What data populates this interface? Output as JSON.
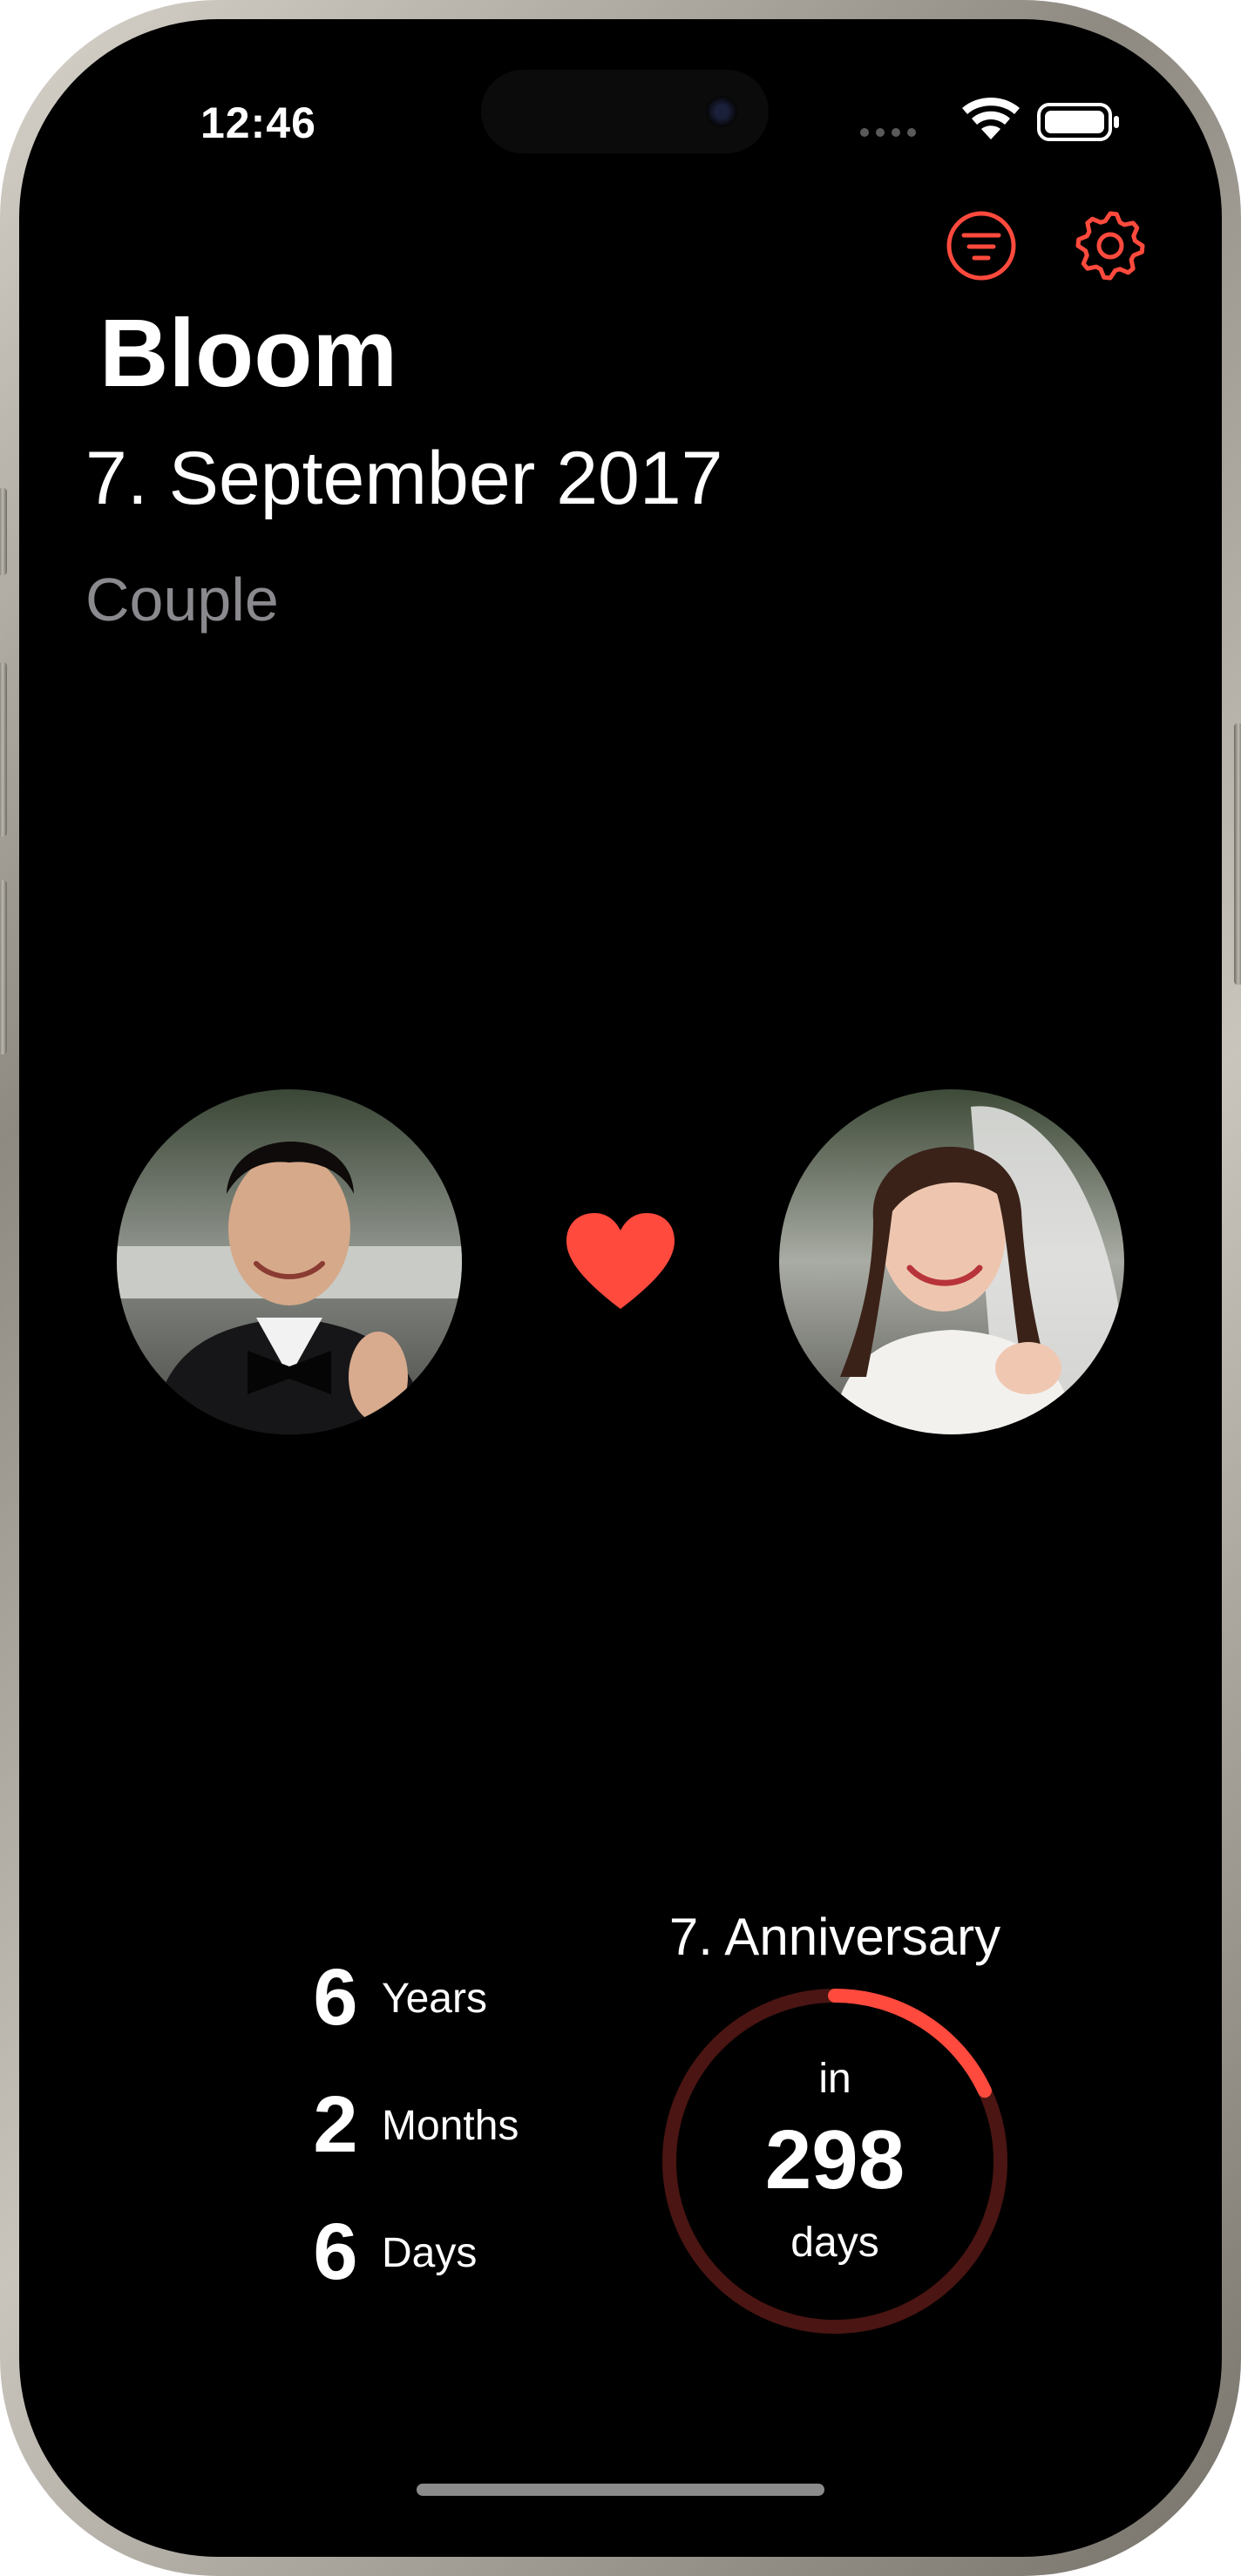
{
  "status_bar": {
    "time": "12:46"
  },
  "header": {
    "title": "Bloom",
    "date": "7. September 2017",
    "subtitle": "Couple",
    "filter_icon": "filter-icon",
    "settings_icon": "gear-icon"
  },
  "couple": {
    "left_avatar": "groom-photo",
    "right_avatar": "bride-photo",
    "heart_icon": "heart-icon"
  },
  "duration": {
    "years_value": "6",
    "years_label": "Years",
    "months_value": "2",
    "months_label": "Months",
    "days_value": "6",
    "days_label": "Days"
  },
  "anniversary": {
    "title": "7. Anniversary",
    "prefix": "in",
    "days_remaining": "298",
    "suffix": "days",
    "progress_fraction": 0.18
  },
  "colors": {
    "accent": "#ff4a3d",
    "ring_track": "#4a1512",
    "background": "#000000",
    "secondary_text": "#8a8a8e"
  }
}
